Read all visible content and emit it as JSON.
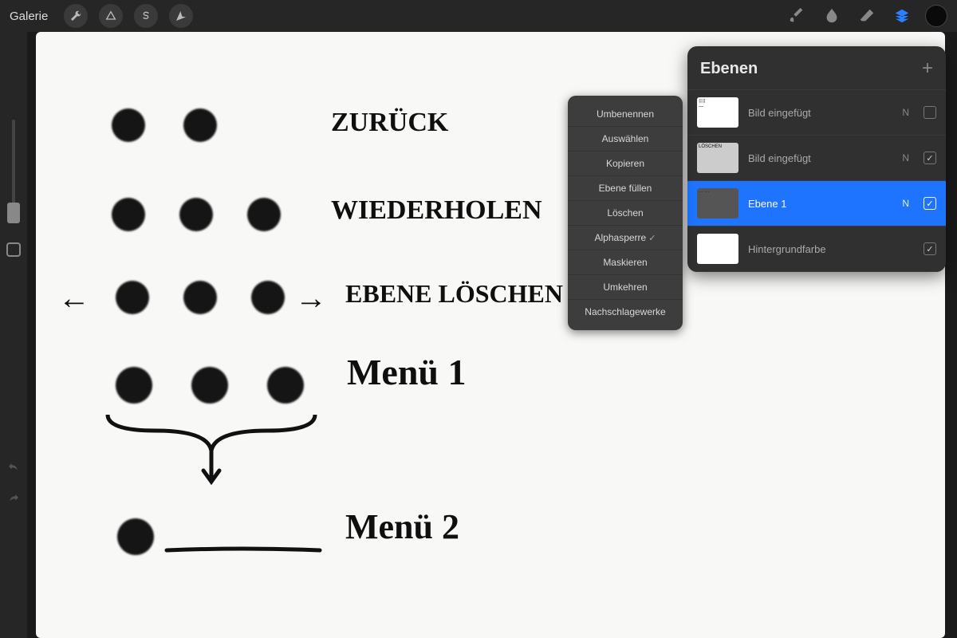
{
  "toolbar": {
    "gallery": "Galerie"
  },
  "canvas": {
    "lines": [
      "ZURÜCK",
      "WIEDERHOLEN",
      "EBENE LÖSCHEN",
      "Menü 1",
      "Menü 2"
    ]
  },
  "context_menu": {
    "items": [
      {
        "label": "Umbenennen",
        "checked": false
      },
      {
        "label": "Auswählen",
        "checked": false
      },
      {
        "label": "Kopieren",
        "checked": false
      },
      {
        "label": "Ebene füllen",
        "checked": false
      },
      {
        "label": "Löschen",
        "checked": false
      },
      {
        "label": "Alphasperre",
        "checked": true
      },
      {
        "label": "Maskieren",
        "checked": false
      },
      {
        "label": "Umkehren",
        "checked": false
      },
      {
        "label": "Nachschlagewerke",
        "checked": false
      }
    ]
  },
  "layers_panel": {
    "title": "Ebenen",
    "layers": [
      {
        "name": "Bild eingefügt",
        "blend": "N",
        "visible": false,
        "selected": false,
        "thumb": "⠿"
      },
      {
        "name": "Bild eingefügt",
        "blend": "N",
        "visible": true,
        "selected": false,
        "thumb": "LÖSCHEN"
      },
      {
        "name": "Ebene 1",
        "blend": "N",
        "visible": true,
        "selected": true,
        "thumb": "···"
      },
      {
        "name": "Hintergrundfarbe",
        "blend": "",
        "visible": true,
        "selected": false,
        "thumb": ""
      }
    ]
  }
}
